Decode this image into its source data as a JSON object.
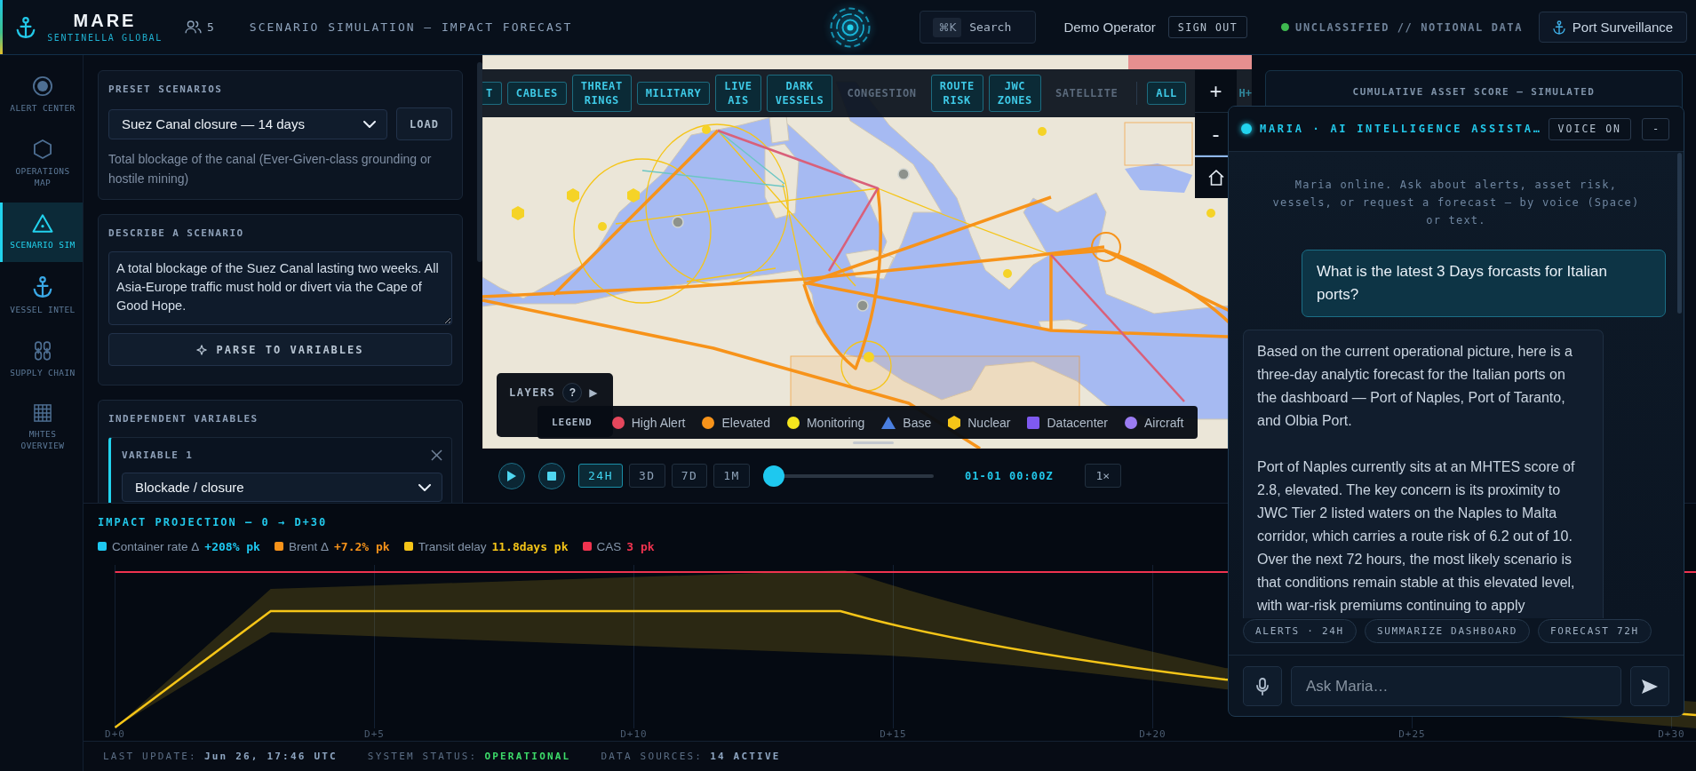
{
  "header": {
    "brand": "MARE",
    "tagline": "SENTINELLA GLOBAL",
    "online_users": "5",
    "title": "SCENARIO SIMULATION — IMPACT FORECAST",
    "search": {
      "shortcut": "⌘K",
      "label": "Search"
    },
    "operator": "Demo Operator",
    "sign_out": "SIGN OUT",
    "classification": "UNCLASSIFIED // NOTIONAL DATA",
    "mode_button": "Port Surveillance"
  },
  "sidebar": {
    "items": [
      {
        "label": "ALERT CENTER",
        "selected": false
      },
      {
        "label": "OPERATIONS MAP",
        "selected": false
      },
      {
        "label": "SCENARIO SIM",
        "selected": true
      },
      {
        "label": "VESSEL INTEL",
        "selected": false
      },
      {
        "label": "SUPPLY CHAIN",
        "selected": false
      },
      {
        "label": "MHTES OVERVIEW",
        "selected": false
      }
    ]
  },
  "scenario_panel": {
    "preset": {
      "heading": "PRESET SCENARIOS",
      "value": "Suez Canal closure — 14 days",
      "button": "LOAD",
      "description": "Total blockage of the canal (Ever-Given-class grounding or hostile mining)"
    },
    "describe": {
      "heading": "DESCRIBE A SCENARIO",
      "value": "A total blockage of the Suez Canal lasting two weeks. All Asia-Europe traffic must hold or divert via the Cape of Good Hope.",
      "button": "PARSE TO VARIABLES"
    },
    "variables": {
      "heading": "INDEPENDENT VARIABLES",
      "items": [
        {
          "label": "VARIABLE 1",
          "value": "Blockade / closure"
        }
      ]
    }
  },
  "map": {
    "layers": [
      {
        "label": "T",
        "on": true
      },
      {
        "label": "CABLES",
        "on": true
      },
      {
        "label": "THREAT RINGS",
        "on": true
      },
      {
        "label": "MILITARY",
        "on": true
      },
      {
        "label": "LIVE AIS",
        "on": true
      },
      {
        "label": "DARK VESSELS",
        "on": true
      },
      {
        "label": "CONGESTION",
        "on": false
      },
      {
        "label": "ROUTE RISK",
        "on": true
      },
      {
        "label": "JWC ZONES",
        "on": true
      },
      {
        "label": "SATELLITE",
        "on": false
      }
    ],
    "all_button": "ALL",
    "cut_layer": "H+",
    "zoom_controls": {
      "zoom_in": "+",
      "zoom_out": "-"
    },
    "layers_panel": {
      "title": "LAYERS",
      "help": "?",
      "expand": "▶"
    },
    "legend": {
      "title": "LEGEND",
      "items": [
        {
          "label": "High Alert",
          "kind": "dot",
          "color": "#e5475c"
        },
        {
          "label": "Elevated",
          "kind": "dot",
          "color": "#f7931a"
        },
        {
          "label": "Monitoring",
          "kind": "dot",
          "color": "#f5e61e"
        },
        {
          "label": "Base",
          "kind": "triangle",
          "color": "#4a7fe0"
        },
        {
          "label": "Nuclear",
          "kind": "hexagon",
          "color": "#f5c518"
        },
        {
          "label": "Datacenter",
          "kind": "square",
          "color": "#7f5af0"
        },
        {
          "label": "Aircraft",
          "kind": "dot",
          "color": "#9b7cf2"
        }
      ]
    }
  },
  "playback": {
    "ranges": [
      {
        "label": "24H",
        "selected": true
      },
      {
        "label": "3D",
        "selected": false
      },
      {
        "label": "7D",
        "selected": false
      },
      {
        "label": "1M",
        "selected": false
      }
    ],
    "level": 0,
    "time": "01-01 00:00Z",
    "speed": "1×"
  },
  "asset_score_panel": {
    "title": "CUMULATIVE ASSET SCORE — SIMULATED"
  },
  "impact_projection": {
    "title": "IMPACT PROJECTION — 0 → D+30",
    "legend": [
      {
        "label": "Container rate Δ",
        "value": "+208% pk",
        "color": "#1ec8f0"
      },
      {
        "label": "Brent Δ",
        "value": "+7.2% pk",
        "color": "#f7931a"
      },
      {
        "label": "Transit delay",
        "value": "11.8days pk",
        "color": "#f5c518"
      },
      {
        "label": "CAS",
        "value": "3 pk",
        "color": "#f0334f"
      }
    ],
    "x_labels": [
      "D+0",
      "D+5",
      "D+10",
      "D+15",
      "D+20",
      "D+25",
      "D+30"
    ]
  },
  "status_bar": {
    "items": [
      {
        "label": "LAST UPDATE:",
        "value": "Jun 26, 17:46 UTC",
        "kind": "info"
      },
      {
        "label": "SYSTEM STATUS:",
        "value": "OPERATIONAL",
        "kind": "ok"
      },
      {
        "label": "DATA SOURCES:",
        "value": "14 ACTIVE",
        "kind": "info"
      }
    ]
  },
  "assistant": {
    "title": "MARIA · AI INTELLIGENCE ASSISTA…",
    "voice_button": "VOICE ON",
    "minimize": "-",
    "intro": "Maria online. Ask about alerts, asset risk, vessels, or request a forecast — by voice (Space) or text.",
    "messages": [
      {
        "kind": "user",
        "text": "What is the latest 3 Days forcasts for Italian ports?"
      },
      {
        "kind": "assistant",
        "paragraphs": [
          "Based on the current operational picture, here is a three-day analytic forecast for the Italian ports on the dashboard — Port of Naples, Port of Taranto, and Olbia Port.",
          "Port of Naples currently sits at an MHTES score of 2.8, elevated. The key concern is its proximity to JWC Tier 2 listed waters on the Naples to Malta corridor, which carries a route risk of 6.2 out of 10. Over the next 72 hours, the most likely scenario is that conditions remain stable at this elevated level, with war-risk premiums continuing to apply"
        ]
      }
    ],
    "chips": [
      "ALERTS · 24H",
      "SUMMARIZE DASHBOARD",
      "FORECAST 72H"
    ],
    "input": {
      "placeholder": "Ask Maria…"
    }
  }
}
